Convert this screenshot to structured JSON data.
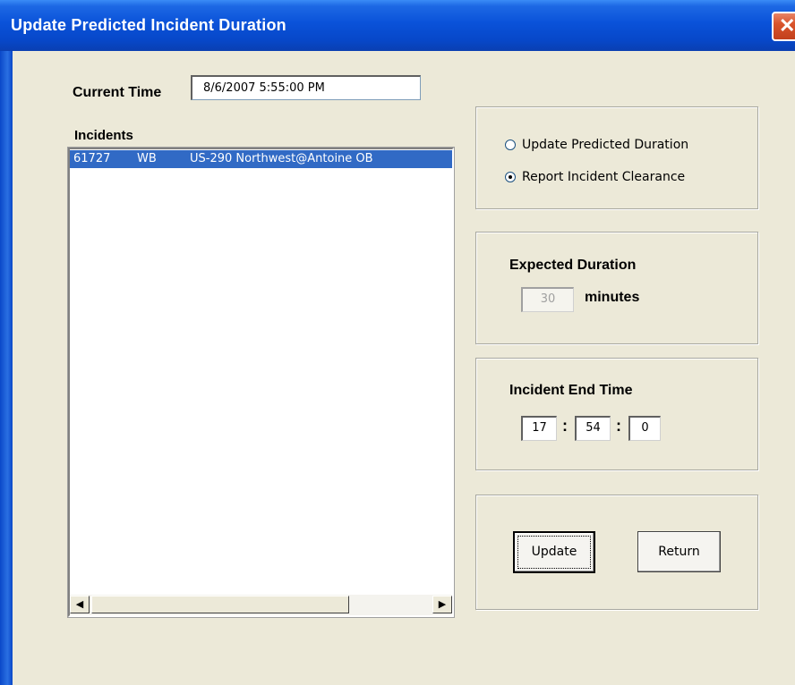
{
  "window": {
    "title": "Update Predicted Incident Duration",
    "close_glyph": "✕"
  },
  "current_time": {
    "label": "Current Time",
    "value": "8/6/2007 5:55:00 PM"
  },
  "incidents": {
    "label": "Incidents",
    "rows": [
      {
        "id": "61727",
        "direction": "WB",
        "location": "US-290 Northwest@Antoine OB",
        "selected": true
      }
    ],
    "scroll_left_glyph": "◀",
    "scroll_right_glyph": "▶"
  },
  "mode": {
    "options": [
      {
        "label": "Update Predicted Duration",
        "checked": false
      },
      {
        "label": "Report Incident Clearance",
        "checked": true
      }
    ]
  },
  "expected_duration": {
    "label": "Expected Duration",
    "value": "30",
    "unit": "minutes",
    "disabled": true
  },
  "end_time": {
    "label": "Incident End Time",
    "hour": "17",
    "minute": "54",
    "second": "0",
    "separator": ":"
  },
  "actions": {
    "update_label": "Update",
    "return_label": "Return"
  },
  "colors": {
    "titlebar": "#0a52d9",
    "selection": "#316ac5",
    "dialog_bg": "#ece9d8"
  }
}
